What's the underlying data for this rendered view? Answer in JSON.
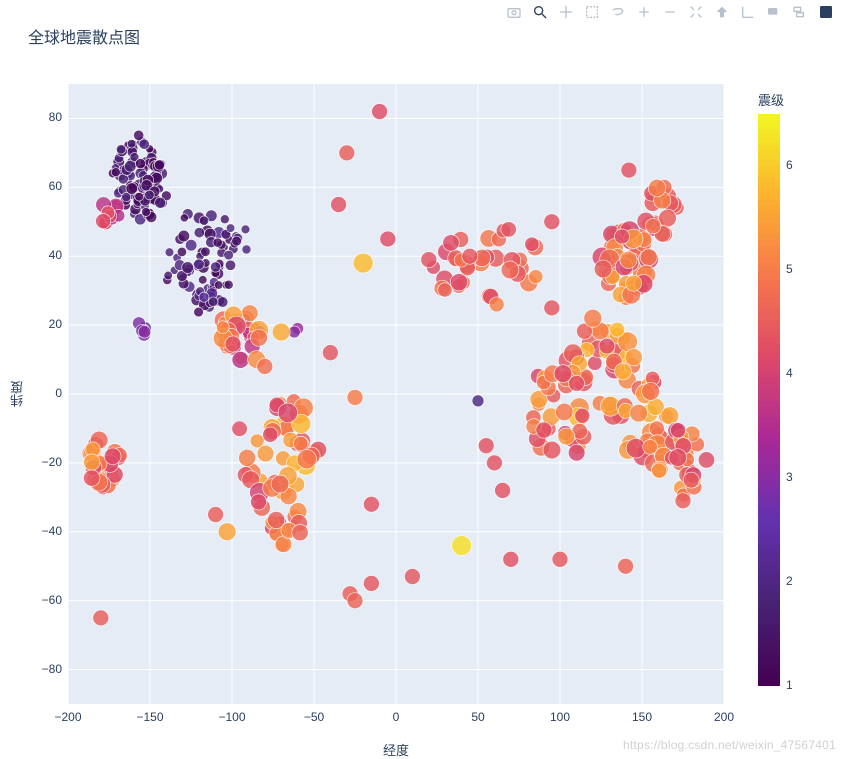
{
  "watermark": "https://blog.csdn.net/weixin_47567401",
  "toolbar": {
    "items": [
      {
        "name": "camera-icon",
        "active": false
      },
      {
        "name": "zoom-icon",
        "active": true
      },
      {
        "name": "pan-icon",
        "active": false
      },
      {
        "name": "boxselect-icon",
        "active": false
      },
      {
        "name": "lassoselect-icon",
        "active": false
      },
      {
        "name": "zoomin-icon",
        "active": false
      },
      {
        "name": "zoomout-icon",
        "active": false
      },
      {
        "name": "autoscale-icon",
        "active": false
      },
      {
        "name": "reset-icon",
        "active": false
      },
      {
        "name": "spike-icon",
        "active": false
      },
      {
        "name": "hover-icon",
        "active": false
      },
      {
        "name": "compare-icon",
        "active": false
      },
      {
        "name": "plotly-icon",
        "active": true
      }
    ]
  },
  "chart_data": {
    "type": "scatter",
    "title": "全球地震散点图",
    "xlabel": "经度",
    "ylabel": "纬度",
    "xlim": [
      -200,
      200
    ],
    "ylim": [
      -90,
      90
    ],
    "x_ticks": [
      -200,
      -150,
      -100,
      -50,
      0,
      50,
      100,
      150,
      200
    ],
    "y_ticks": [
      -80,
      -60,
      -40,
      -20,
      0,
      20,
      40,
      60,
      80
    ],
    "colorbar": {
      "label": "震级",
      "min": 1,
      "max": 6.5,
      "ticks": [
        1,
        2,
        3,
        4,
        5,
        6
      ]
    },
    "clusters": [
      {
        "cx": -155,
        "cy": 63,
        "r": 18,
        "n": 70,
        "mag": [
          1.0,
          2.0
        ],
        "size": [
          4,
          6
        ]
      },
      {
        "cx": -120,
        "cy": 38,
        "r": 22,
        "n": 70,
        "mag": [
          1.0,
          2.2
        ],
        "size": [
          4,
          6
        ]
      },
      {
        "cx": -150,
        "cy": 58,
        "r": 8,
        "n": 20,
        "mag": [
          1.0,
          2.0
        ],
        "size": [
          4,
          6
        ]
      },
      {
        "cx": -100,
        "cy": 45,
        "r": 10,
        "n": 12,
        "mag": [
          1.2,
          2.0
        ],
        "size": [
          4,
          5
        ]
      },
      {
        "cx": -95,
        "cy": 18,
        "r": 12,
        "n": 30,
        "mag": [
          3.5,
          5.5
        ],
        "size": [
          6,
          10
        ]
      },
      {
        "cx": -72,
        "cy": -15,
        "r": 25,
        "n": 40,
        "mag": [
          4.0,
          5.8
        ],
        "size": [
          7,
          10
        ]
      },
      {
        "cx": -70,
        "cy": -35,
        "r": 15,
        "n": 18,
        "mag": [
          4.0,
          5.5
        ],
        "size": [
          7,
          9
        ]
      },
      {
        "cx": -178,
        "cy": -20,
        "r": 10,
        "n": 28,
        "mag": [
          4.0,
          5.5
        ],
        "size": [
          7,
          9
        ]
      },
      {
        "cx": -175,
        "cy": 52,
        "r": 6,
        "n": 12,
        "mag": [
          3.5,
          4.5
        ],
        "size": [
          6,
          8
        ]
      },
      {
        "cx": 140,
        "cy": 38,
        "r": 15,
        "n": 45,
        "mag": [
          4.0,
          5.5
        ],
        "size": [
          7,
          10
        ]
      },
      {
        "cx": 125,
        "cy": 5,
        "r": 22,
        "n": 40,
        "mag": [
          4.0,
          5.8
        ],
        "size": [
          7,
          10
        ]
      },
      {
        "cx": 100,
        "cy": -5,
        "r": 20,
        "n": 30,
        "mag": [
          4.0,
          5.5
        ],
        "size": [
          7,
          9
        ]
      },
      {
        "cx": 155,
        "cy": -8,
        "r": 18,
        "n": 30,
        "mag": [
          4.0,
          5.8
        ],
        "size": [
          7,
          10
        ]
      },
      {
        "cx": 175,
        "cy": -20,
        "r": 15,
        "n": 25,
        "mag": [
          4.0,
          5.5
        ],
        "size": [
          7,
          9
        ]
      },
      {
        "cx": 70,
        "cy": 35,
        "r": 20,
        "n": 20,
        "mag": [
          4.0,
          5.2
        ],
        "size": [
          7,
          9
        ]
      },
      {
        "cx": 30,
        "cy": 38,
        "r": 15,
        "n": 15,
        "mag": [
          4.0,
          5.0
        ],
        "size": [
          7,
          9
        ]
      },
      {
        "cx": 160,
        "cy": 53,
        "r": 12,
        "n": 20,
        "mag": [
          4.0,
          5.2
        ],
        "size": [
          7,
          9
        ]
      },
      {
        "cx": -155,
        "cy": 19,
        "r": 3,
        "n": 6,
        "mag": [
          2.0,
          3.0
        ],
        "size": [
          5,
          7
        ]
      }
    ],
    "points": [
      {
        "x": -10,
        "y": 82,
        "mag": 4.2,
        "size": 8
      },
      {
        "x": -30,
        "y": 70,
        "mag": 4.5,
        "size": 8
      },
      {
        "x": -35,
        "y": 55,
        "mag": 4.3,
        "size": 8
      },
      {
        "x": -20,
        "y": 38,
        "mag": 5.8,
        "size": 10
      },
      {
        "x": -5,
        "y": 45,
        "mag": 4.2,
        "size": 8
      },
      {
        "x": -40,
        "y": 12,
        "mag": 4.4,
        "size": 8
      },
      {
        "x": -25,
        "y": -1,
        "mag": 5.0,
        "size": 8
      },
      {
        "x": -15,
        "y": -32,
        "mag": 4.3,
        "size": 8
      },
      {
        "x": -15,
        "y": -55,
        "mag": 4.4,
        "size": 8
      },
      {
        "x": -28,
        "y": -58,
        "mag": 4.5,
        "size": 8
      },
      {
        "x": -25,
        "y": -60,
        "mag": 4.6,
        "size": 8
      },
      {
        "x": 20,
        "y": 39,
        "mag": 4.3,
        "size": 8
      },
      {
        "x": 45,
        "y": 40,
        "mag": 4.4,
        "size": 8
      },
      {
        "x": 50,
        "y": -2,
        "mag": 2.0,
        "size": 6
      },
      {
        "x": 55,
        "y": -15,
        "mag": 4.3,
        "size": 8
      },
      {
        "x": 40,
        "y": -44,
        "mag": 6.2,
        "size": 10
      },
      {
        "x": 10,
        "y": -53,
        "mag": 4.4,
        "size": 8
      },
      {
        "x": 65,
        "y": -28,
        "mag": 4.3,
        "size": 8
      },
      {
        "x": 60,
        "y": -20,
        "mag": 4.3,
        "size": 8
      },
      {
        "x": 95,
        "y": 25,
        "mag": 4.4,
        "size": 8
      },
      {
        "x": 95,
        "y": 50,
        "mag": 4.3,
        "size": 8
      },
      {
        "x": 120,
        "y": 22,
        "mag": 5.0,
        "size": 9
      },
      {
        "x": 142,
        "y": 65,
        "mag": 4.3,
        "size": 8
      },
      {
        "x": 180,
        "y": -25,
        "mag": 4.4,
        "size": 8
      },
      {
        "x": 175,
        "y": -31,
        "mag": 4.5,
        "size": 8
      },
      {
        "x": 140,
        "y": -50,
        "mag": 4.6,
        "size": 8
      },
      {
        "x": 100,
        "y": -48,
        "mag": 4.4,
        "size": 8
      },
      {
        "x": 70,
        "y": -48,
        "mag": 4.3,
        "size": 8
      },
      {
        "x": -60,
        "y": 19,
        "mag": 3.2,
        "size": 6
      },
      {
        "x": -62,
        "y": 18,
        "mag": 3.0,
        "size": 6
      },
      {
        "x": -85,
        "y": 10,
        "mag": 5.2,
        "size": 9
      },
      {
        "x": -80,
        "y": 8,
        "mag": 4.8,
        "size": 8
      },
      {
        "x": -103,
        "y": -40,
        "mag": 5.5,
        "size": 9
      },
      {
        "x": -110,
        "y": -35,
        "mag": 4.5,
        "size": 8
      },
      {
        "x": -180,
        "y": -65,
        "mag": 4.5,
        "size": 8
      },
      {
        "x": -70,
        "y": 18,
        "mag": 5.6,
        "size": 9
      }
    ]
  }
}
